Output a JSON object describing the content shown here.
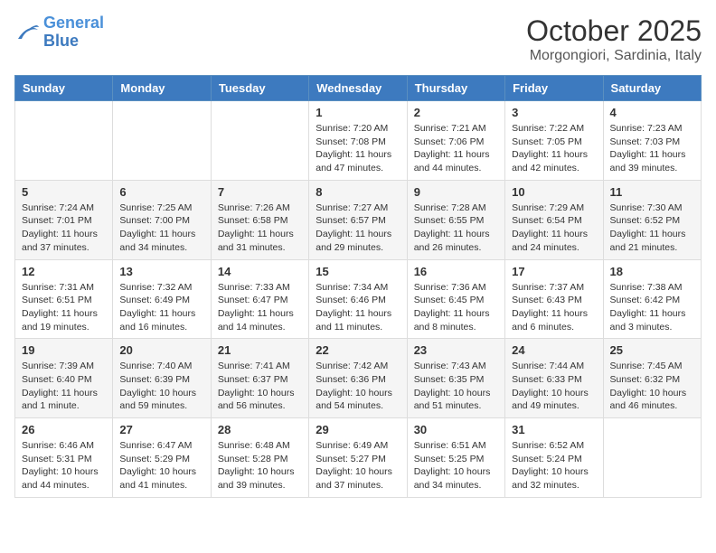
{
  "header": {
    "logo_line1": "General",
    "logo_line2": "Blue",
    "month": "October 2025",
    "location": "Morgongiori, Sardinia, Italy"
  },
  "days_of_week": [
    "Sunday",
    "Monday",
    "Tuesday",
    "Wednesday",
    "Thursday",
    "Friday",
    "Saturday"
  ],
  "weeks": [
    [
      {
        "day": "",
        "info": ""
      },
      {
        "day": "",
        "info": ""
      },
      {
        "day": "",
        "info": ""
      },
      {
        "day": "1",
        "info": "Sunrise: 7:20 AM\nSunset: 7:08 PM\nDaylight: 11 hours and 47 minutes."
      },
      {
        "day": "2",
        "info": "Sunrise: 7:21 AM\nSunset: 7:06 PM\nDaylight: 11 hours and 44 minutes."
      },
      {
        "day": "3",
        "info": "Sunrise: 7:22 AM\nSunset: 7:05 PM\nDaylight: 11 hours and 42 minutes."
      },
      {
        "day": "4",
        "info": "Sunrise: 7:23 AM\nSunset: 7:03 PM\nDaylight: 11 hours and 39 minutes."
      }
    ],
    [
      {
        "day": "5",
        "info": "Sunrise: 7:24 AM\nSunset: 7:01 PM\nDaylight: 11 hours and 37 minutes."
      },
      {
        "day": "6",
        "info": "Sunrise: 7:25 AM\nSunset: 7:00 PM\nDaylight: 11 hours and 34 minutes."
      },
      {
        "day": "7",
        "info": "Sunrise: 7:26 AM\nSunset: 6:58 PM\nDaylight: 11 hours and 31 minutes."
      },
      {
        "day": "8",
        "info": "Sunrise: 7:27 AM\nSunset: 6:57 PM\nDaylight: 11 hours and 29 minutes."
      },
      {
        "day": "9",
        "info": "Sunrise: 7:28 AM\nSunset: 6:55 PM\nDaylight: 11 hours and 26 minutes."
      },
      {
        "day": "10",
        "info": "Sunrise: 7:29 AM\nSunset: 6:54 PM\nDaylight: 11 hours and 24 minutes."
      },
      {
        "day": "11",
        "info": "Sunrise: 7:30 AM\nSunset: 6:52 PM\nDaylight: 11 hours and 21 minutes."
      }
    ],
    [
      {
        "day": "12",
        "info": "Sunrise: 7:31 AM\nSunset: 6:51 PM\nDaylight: 11 hours and 19 minutes."
      },
      {
        "day": "13",
        "info": "Sunrise: 7:32 AM\nSunset: 6:49 PM\nDaylight: 11 hours and 16 minutes."
      },
      {
        "day": "14",
        "info": "Sunrise: 7:33 AM\nSunset: 6:47 PM\nDaylight: 11 hours and 14 minutes."
      },
      {
        "day": "15",
        "info": "Sunrise: 7:34 AM\nSunset: 6:46 PM\nDaylight: 11 hours and 11 minutes."
      },
      {
        "day": "16",
        "info": "Sunrise: 7:36 AM\nSunset: 6:45 PM\nDaylight: 11 hours and 8 minutes."
      },
      {
        "day": "17",
        "info": "Sunrise: 7:37 AM\nSunset: 6:43 PM\nDaylight: 11 hours and 6 minutes."
      },
      {
        "day": "18",
        "info": "Sunrise: 7:38 AM\nSunset: 6:42 PM\nDaylight: 11 hours and 3 minutes."
      }
    ],
    [
      {
        "day": "19",
        "info": "Sunrise: 7:39 AM\nSunset: 6:40 PM\nDaylight: 11 hours and 1 minute."
      },
      {
        "day": "20",
        "info": "Sunrise: 7:40 AM\nSunset: 6:39 PM\nDaylight: 10 hours and 59 minutes."
      },
      {
        "day": "21",
        "info": "Sunrise: 7:41 AM\nSunset: 6:37 PM\nDaylight: 10 hours and 56 minutes."
      },
      {
        "day": "22",
        "info": "Sunrise: 7:42 AM\nSunset: 6:36 PM\nDaylight: 10 hours and 54 minutes."
      },
      {
        "day": "23",
        "info": "Sunrise: 7:43 AM\nSunset: 6:35 PM\nDaylight: 10 hours and 51 minutes."
      },
      {
        "day": "24",
        "info": "Sunrise: 7:44 AM\nSunset: 6:33 PM\nDaylight: 10 hours and 49 minutes."
      },
      {
        "day": "25",
        "info": "Sunrise: 7:45 AM\nSunset: 6:32 PM\nDaylight: 10 hours and 46 minutes."
      }
    ],
    [
      {
        "day": "26",
        "info": "Sunrise: 6:46 AM\nSunset: 5:31 PM\nDaylight: 10 hours and 44 minutes."
      },
      {
        "day": "27",
        "info": "Sunrise: 6:47 AM\nSunset: 5:29 PM\nDaylight: 10 hours and 41 minutes."
      },
      {
        "day": "28",
        "info": "Sunrise: 6:48 AM\nSunset: 5:28 PM\nDaylight: 10 hours and 39 minutes."
      },
      {
        "day": "29",
        "info": "Sunrise: 6:49 AM\nSunset: 5:27 PM\nDaylight: 10 hours and 37 minutes."
      },
      {
        "day": "30",
        "info": "Sunrise: 6:51 AM\nSunset: 5:25 PM\nDaylight: 10 hours and 34 minutes."
      },
      {
        "day": "31",
        "info": "Sunrise: 6:52 AM\nSunset: 5:24 PM\nDaylight: 10 hours and 32 minutes."
      },
      {
        "day": "",
        "info": ""
      }
    ]
  ]
}
